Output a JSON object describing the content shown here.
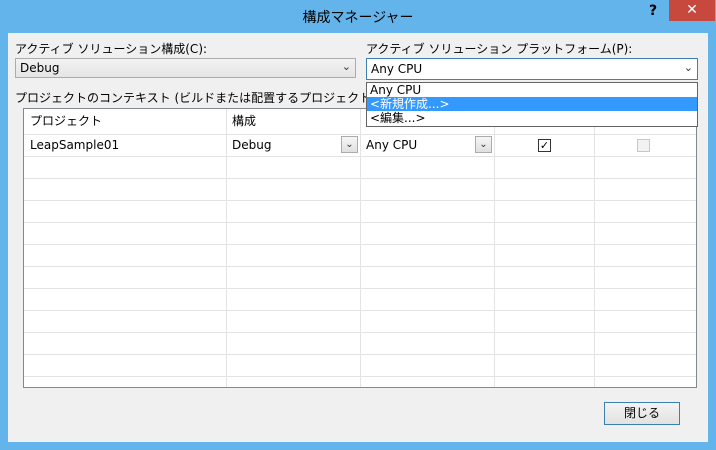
{
  "window": {
    "title": "構成マネージャー",
    "help_glyph": "?",
    "close_glyph": "✕"
  },
  "solution_config": {
    "label": "アクティブ ソリューション構成(C):",
    "value": "Debug"
  },
  "solution_platform": {
    "label": "アクティブ ソリューション プラットフォーム(P):",
    "value": "Any CPU",
    "options": [
      "Any CPU",
      "<新規作成...>",
      "<編集...>"
    ],
    "highlighted_index": 1
  },
  "context_label": "プロジェクトのコンテキスト (ビルドまたは配置するプロジェクト構成をチェック)(",
  "grid": {
    "headers": [
      "プロジェクト",
      "構成"
    ],
    "rows": [
      {
        "project": "LeapSample01",
        "configuration": "Debug",
        "platform": "Any CPU",
        "build": true,
        "deploy": false,
        "deploy_enabled": false
      }
    ]
  },
  "buttons": {
    "close": "閉じる"
  },
  "icons": {
    "dropdown_arrow": "chevron-down-icon",
    "checkmark": "check-icon"
  },
  "colors": {
    "titlebar": "#64b4ec",
    "close_button": "#c7483d",
    "selection": "#3399ff"
  }
}
